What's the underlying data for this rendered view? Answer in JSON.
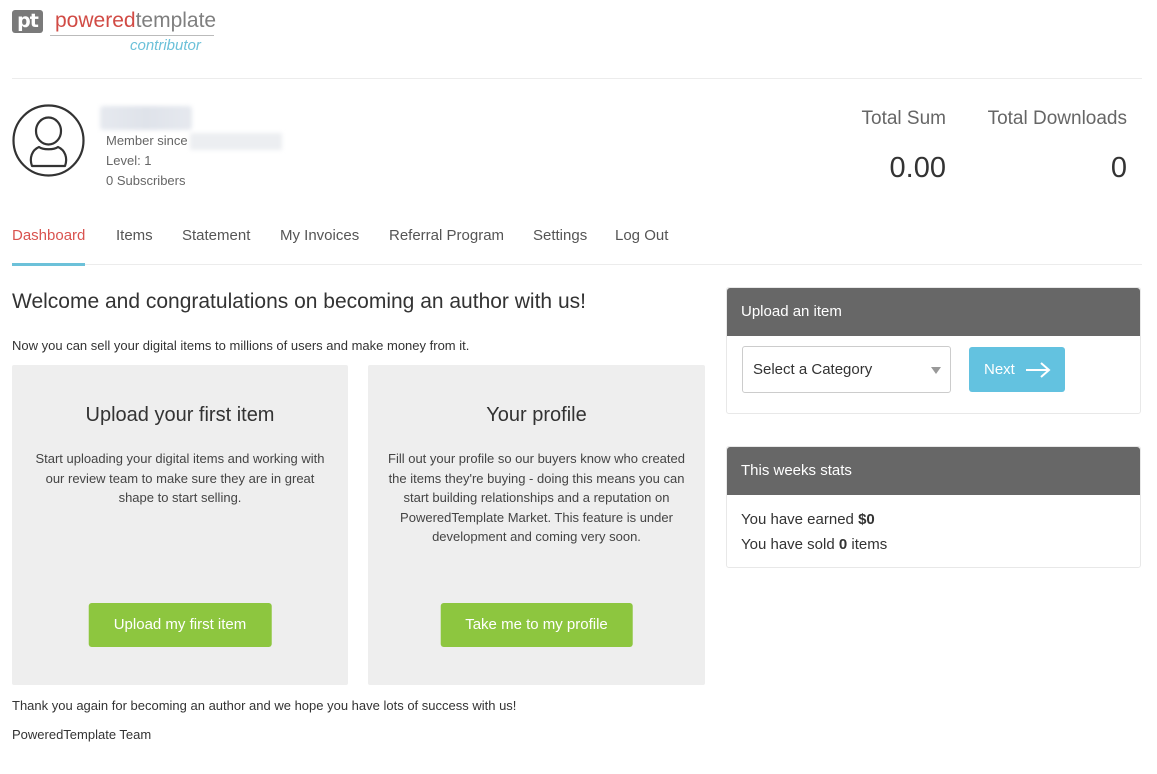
{
  "logo": {
    "mark": "pt",
    "brand_part1": "powered",
    "brand_part2": "template",
    "subtitle": "contributor",
    "colors": {
      "powered": "#d14b45",
      "template": "#7f7f7f",
      "subtitle": "#6cc1d9"
    }
  },
  "profile": {
    "avatar_icon": "user-circle-icon",
    "member_since_label": "Member since",
    "level": "Level: 1",
    "subscribers": "0 Subscribers"
  },
  "stats": {
    "total_sum_label": "Total Sum",
    "total_sum_value": "0.00",
    "total_downloads_label": "Total Downloads",
    "total_downloads_value": "0"
  },
  "nav": {
    "active": "Dashboard",
    "tabs": [
      {
        "label": "Dashboard"
      },
      {
        "label": "Items"
      },
      {
        "label": "Statement"
      },
      {
        "label": "My Invoices"
      },
      {
        "label": "Referral Program"
      },
      {
        "label": "Settings"
      },
      {
        "label": "Log Out"
      }
    ]
  },
  "main": {
    "welcome": "Welcome and congratulations on becoming an author with us!",
    "intro": "Now you can sell your digital items to millions of users and make money from it.",
    "cards": [
      {
        "title": "Upload your first item",
        "text": "Start uploading your digital items and working with our review team to make sure they are in great shape to start selling.",
        "button": "Upload my first item"
      },
      {
        "title": "Your profile",
        "text": "Fill out your profile so our buyers know who created the items they're buying - doing this means you can start building relationships and a reputation on PoweredTemplate Market. This feature is under development and coming very soon.",
        "button": "Take me to my profile"
      }
    ],
    "outro": "Thank you again for becoming an author and we hope you have lots of success with us!",
    "signature": "PoweredTemplate Team"
  },
  "upload_panel": {
    "title": "Upload an item",
    "select_value": "Select a Category",
    "next_label": "Next",
    "next_icon": "arrow-right-icon"
  },
  "weekly_stats": {
    "title": "This weeks stats",
    "earned_prefix": "You have earned",
    "earned_value": "$0",
    "sold_prefix": "You have sold",
    "sold_value": "0",
    "sold_suffix": "items"
  },
  "colors": {
    "accent_red": "#d9534f",
    "accent_blue": "#6cc1d9",
    "button_green": "#8dc63f",
    "button_blue": "#63c2e0",
    "panel_header": "#676767"
  }
}
